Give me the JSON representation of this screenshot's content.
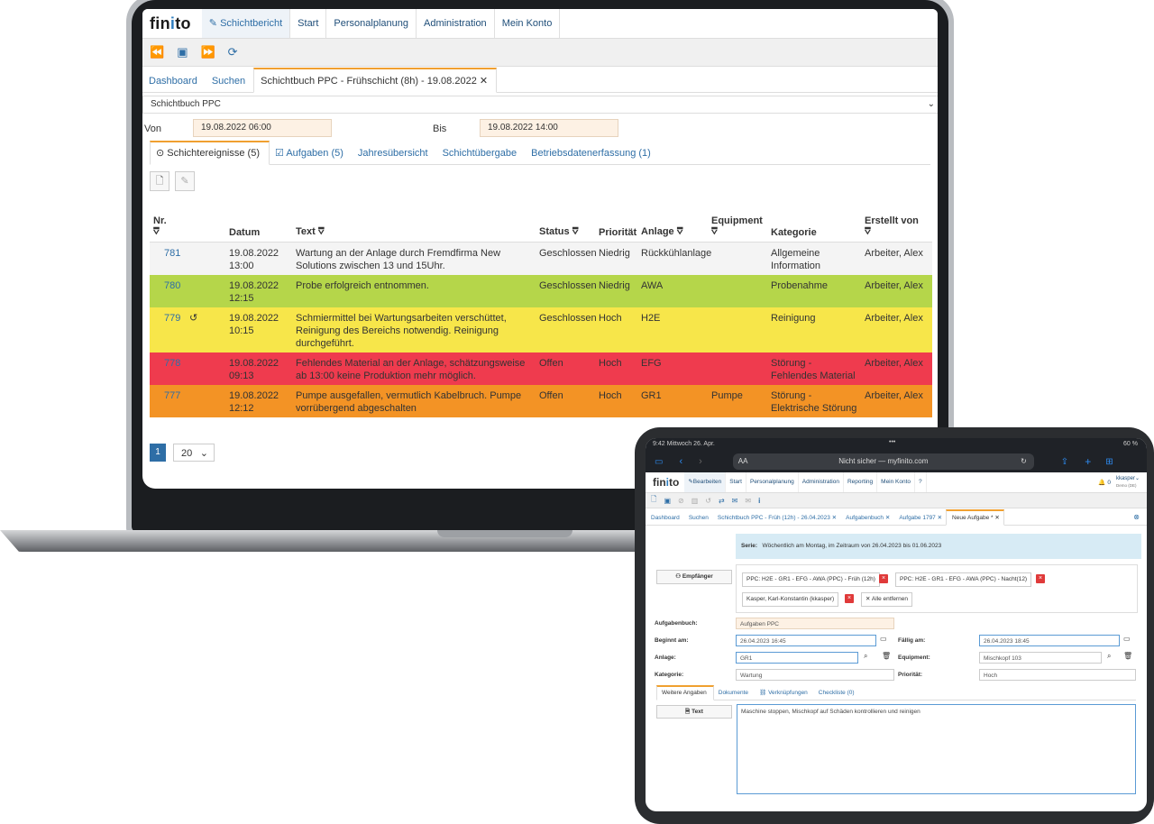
{
  "laptop": {
    "logo": "finito",
    "nav": [
      "Schichtbericht",
      "Start",
      "Personalplanung",
      "Administration",
      "Mein Konto"
    ],
    "toolbar_icons": [
      "rewind-icon",
      "calendar-icon",
      "fast-forward-icon",
      "refresh-icon"
    ],
    "tabs": [
      "Dashboard",
      "Suchen",
      "Schichtbuch PPC - Frühschicht (8h) - 19.08.2022 ✕"
    ],
    "selector": "Schichtbuch PPC",
    "von_label": "Von",
    "von_value": "19.08.2022 06:00",
    "bis_label": "Bis",
    "bis_value": "19.08.2022 14:00",
    "subtabs": [
      "Schichtereignisse (5)",
      "Aufgaben (5)",
      "Jahresübersicht",
      "Schichtübergabe",
      "Betriebsdatenerfassung (1)"
    ],
    "columns": [
      "Nr.",
      "Datum",
      "Text",
      "Status",
      "Priorität",
      "Anlage",
      "Equipment",
      "Kategorie",
      "Erstellt von"
    ],
    "rows": [
      {
        "nr": "781",
        "datum": "19.08.2022 13:00",
        "text": "Wartung an der Anlage durch Fremdfirma New Solutions zwischen 13 und 15Uhr.",
        "status": "Geschlossen",
        "prio": "Niedrig",
        "anlage": "Rückkühlanlage",
        "equipment": "",
        "kategorie": "Allgemeine Information",
        "erstellt": "Arbeiter, Alex",
        "color": "#f4f4f4"
      },
      {
        "nr": "780",
        "datum": "19.08.2022 12:15",
        "text": "Probe erfolgreich entnommen.",
        "status": "Geschlossen",
        "prio": "Niedrig",
        "anlage": "AWA",
        "equipment": "",
        "kategorie": "Probenahme",
        "erstellt": "Arbeiter, Alex",
        "color": "#b5d64a"
      },
      {
        "nr": "779",
        "datum": "19.08.2022 10:15",
        "text": "Schmiermittel bei Wartungsarbeiten verschüttet, Reinigung des Bereichs notwendig. Reinigung durchgeführt.",
        "status": "Geschlossen",
        "prio": "Hoch",
        "anlage": "H2E",
        "equipment": "",
        "kategorie": "Reinigung",
        "erstellt": "Arbeiter, Alex",
        "color": "#f7e64a"
      },
      {
        "nr": "778",
        "datum": "19.08.2022 09:13",
        "text": "Fehlendes Material an der Anlage, schätzungsweise ab 13:00 keine Produktion mehr möglich.",
        "status": "Offen",
        "prio": "Hoch",
        "anlage": "EFG",
        "equipment": "",
        "kategorie": "Störung - Fehlendes Material",
        "erstellt": "Arbeiter, Alex",
        "color": "#ef3b4e"
      },
      {
        "nr": "777",
        "datum": "19.08.2022 12:12",
        "text": "Pumpe ausgefallen, vermutlich Kabelbruch. Pumpe vorrübergend abgeschalten",
        "status": "Offen",
        "prio": "Hoch",
        "anlage": "GR1",
        "equipment": "Pumpe",
        "kategorie": "Störung - Elektrische Störung",
        "erstellt": "Arbeiter, Alex",
        "color": "#f39325"
      }
    ],
    "page": "1",
    "page_size": "20"
  },
  "tablet": {
    "status_left": "9:42  Mittwoch 26. Apr.",
    "status_right": "60 %",
    "url": "Nicht sicher — myfinito.com",
    "url_aa": "AA",
    "logo": "finito",
    "nav": [
      "Bearbeiten",
      "Start",
      "Personalplanung",
      "Administration",
      "Reporting",
      "Mein Konto",
      "?"
    ],
    "bell_count": "0",
    "user": "kkasper",
    "user_sub": "Demo (DE)",
    "tabs": [
      "Dashboard",
      "Suchen",
      "Schichtbuch PPC - Früh (12h) - 26.04.2023 ✕",
      "Aufgabenbuch ✕",
      "Aufgabe 1797 ✕",
      "Neue Aufgabe * ✕"
    ],
    "serie_label": "Serie:",
    "serie_text": "Wöchentlich am Montag, im Zeitraum von 26.04.2023 bis 01.06.2023",
    "empfaenger_btn": "Empfänger",
    "chips": [
      "PPC: H2E - GR1 - EFG - AWA (PPC) - Früh (12h)",
      "PPC: H2E - GR1 - EFG - AWA (PPC) - Nacht(12)",
      "Kasper, Karl-Konstantin (kkasper)"
    ],
    "alle_entfernen": "✕ Alle entfernen",
    "aufgabenbuch_label": "Aufgabenbuch:",
    "aufgabenbuch_value": "Aufgaben PPC",
    "beginnt_label": "Beginnt am:",
    "beginnt_value": "26.04.2023 16:45",
    "faellig_label": "Fällig am:",
    "faellig_value": "26.04.2023 18:45",
    "anlage_label": "Anlage:",
    "anlage_value": "GR1",
    "equipment_label": "Equipment:",
    "equipment_value": "Mischkopf 103",
    "kategorie_label": "Kategorie:",
    "kategorie_value": "Wartung",
    "prioritaet_label": "Priorität:",
    "prioritaet_value": "Hoch",
    "subtabs": [
      "Weitere Angaben",
      "Dokumente",
      "Verknüpfungen",
      "Checkliste (0)"
    ],
    "text_btn": "Text",
    "text_value": "Maschine stoppen, Mischkopf auf Schäden kontrollieren und reinigen"
  }
}
